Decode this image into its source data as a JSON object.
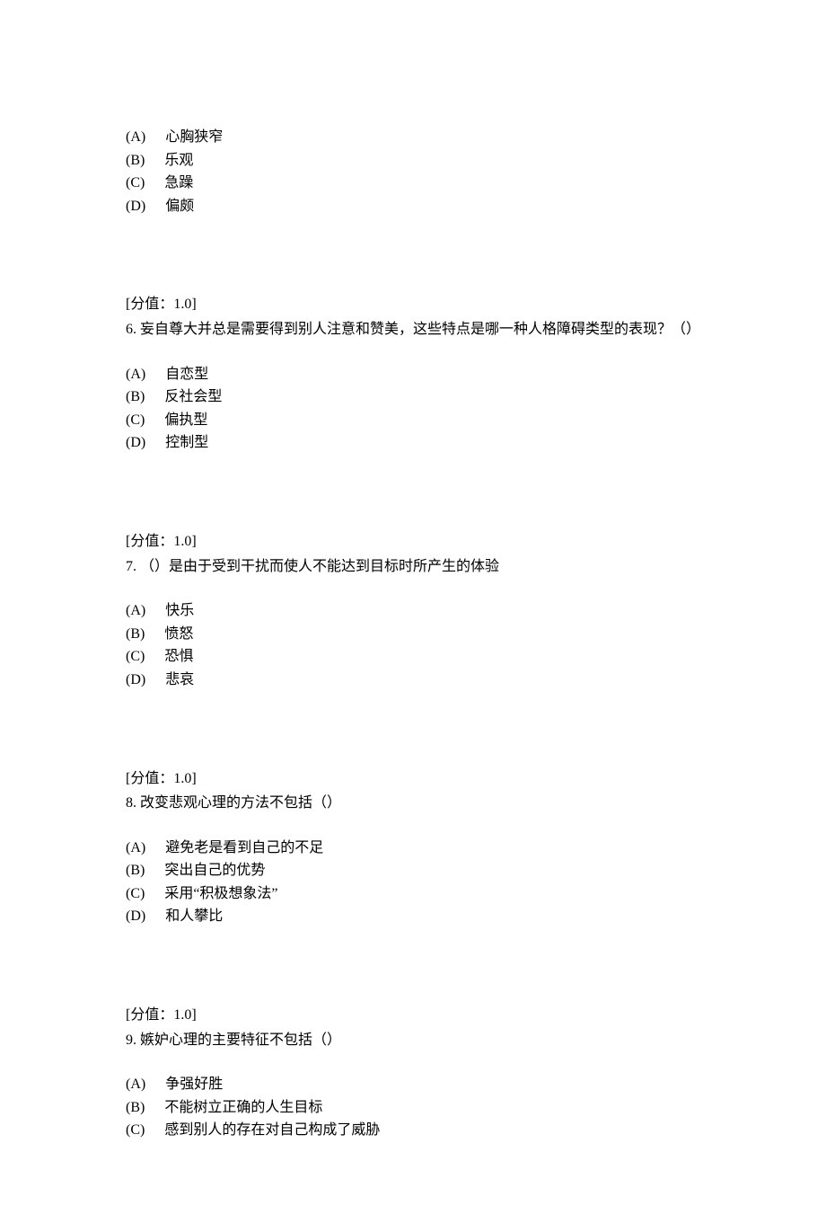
{
  "q5_tail": {
    "options": [
      {
        "label": "(A)",
        "text": "心胸狭窄"
      },
      {
        "label": "(B)",
        "text": "乐观"
      },
      {
        "label": "(C)",
        "text": "急躁"
      },
      {
        "label": "(D)",
        "text": "偏颇"
      }
    ]
  },
  "q6": {
    "score": "[分值：1.0]",
    "text": " 6. 妄自尊大并总是需要得到别人注意和赞美，这些特点是哪一种人格障碍类型的表现？（）",
    "options": [
      {
        "label": "(A)",
        "text": "自恋型"
      },
      {
        "label": "(B)",
        "text": "反社会型"
      },
      {
        "label": "(C)",
        "text": "偏执型"
      },
      {
        "label": "(D)",
        "text": "控制型"
      }
    ]
  },
  "q7": {
    "score": "[分值：1.0]",
    "text": " 7. （）是由于受到干扰而使人不能达到目标时所产生的体验",
    "options": [
      {
        "label": "(A)",
        "text": "快乐"
      },
      {
        "label": "(B)",
        "text": "愤怒"
      },
      {
        "label": "(C)",
        "text": "恐惧"
      },
      {
        "label": "(D)",
        "text": "悲哀"
      }
    ]
  },
  "q8": {
    "score": "[分值：1.0]",
    "text": " 8. 改变悲观心理的方法不包括（）",
    "options": [
      {
        "label": "(A)",
        "text": "避免老是看到自己的不足"
      },
      {
        "label": "(B)",
        "text": "突出自己的优势"
      },
      {
        "label": "(C)",
        "text": "采用“积极想象法”"
      },
      {
        "label": "(D)",
        "text": "和人攀比"
      }
    ]
  },
  "q9": {
    "score": "[分值：1.0]",
    "text": " 9. 嫉妒心理的主要特征不包括（）",
    "options": [
      {
        "label": "(A)",
        "text": "争强好胜"
      },
      {
        "label": "(B)",
        "text": "不能树立正确的人生目标"
      },
      {
        "label": "(C)",
        "text": "感到别人的存在对自己构成了威胁"
      }
    ]
  }
}
